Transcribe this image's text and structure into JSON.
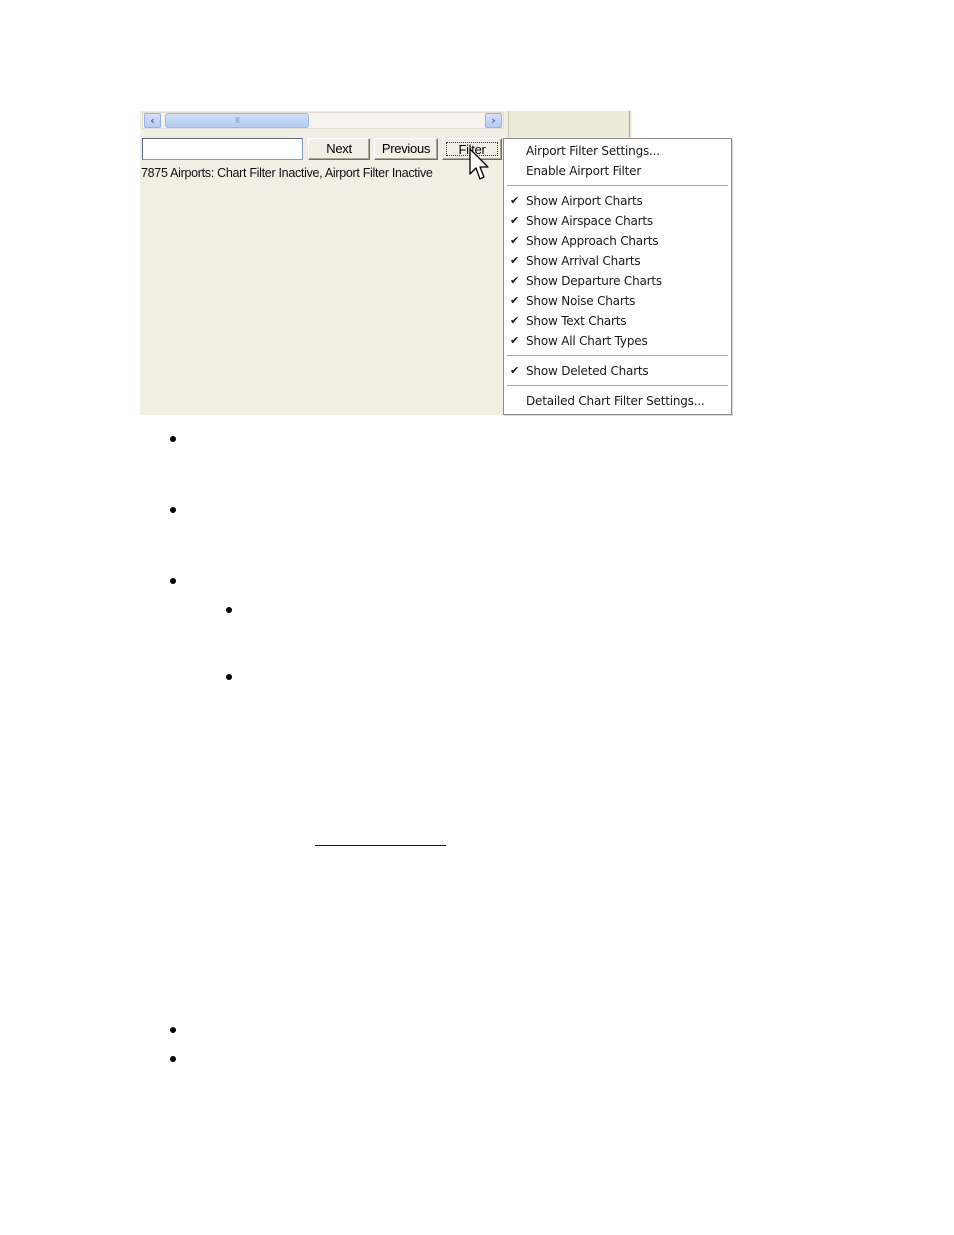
{
  "screenshot": {
    "scroll_left_icon": "chevron-left",
    "scroll_right_icon": "chevron-right",
    "scroll_thumb_grip": "III",
    "find_input": {
      "value": "",
      "placeholder": ""
    },
    "buttons": {
      "next": "Next",
      "previous": "Previous",
      "filter": "Filter"
    },
    "status_text": "7875 Airports: Chart Filter Inactive, Airport Filter Inactive",
    "cursor_icon": "arrow-pointer"
  },
  "filter_menu": {
    "groups": [
      {
        "items": [
          {
            "label": "Airport Filter Settings...",
            "checked": false
          },
          {
            "label": "Enable Airport Filter",
            "checked": false
          }
        ]
      },
      {
        "items": [
          {
            "label": "Show Airport Charts",
            "checked": true
          },
          {
            "label": "Show Airspace Charts",
            "checked": true
          },
          {
            "label": "Show Approach Charts",
            "checked": true
          },
          {
            "label": "Show Arrival Charts",
            "checked": true
          },
          {
            "label": "Show Departure Charts",
            "checked": true
          },
          {
            "label": "Show Noise Charts",
            "checked": true
          },
          {
            "label": "Show Text Charts",
            "checked": true
          },
          {
            "label": "Show All Chart Types",
            "checked": true
          }
        ]
      },
      {
        "items": [
          {
            "label": "Show Deleted Charts",
            "checked": true
          }
        ]
      },
      {
        "items": [
          {
            "label": "Detailed Chart Filter Settings...",
            "checked": false
          }
        ]
      }
    ],
    "check_glyph": "✔"
  },
  "document": {
    "bullets_level1_group1": 3,
    "bullets_level2": 2,
    "bullets_level1_group2": 2,
    "link_text": ""
  },
  "colors": {
    "link": "#0000d0",
    "scroll_accent": "#b6cbf5",
    "window_bg": "#f1efe3"
  }
}
